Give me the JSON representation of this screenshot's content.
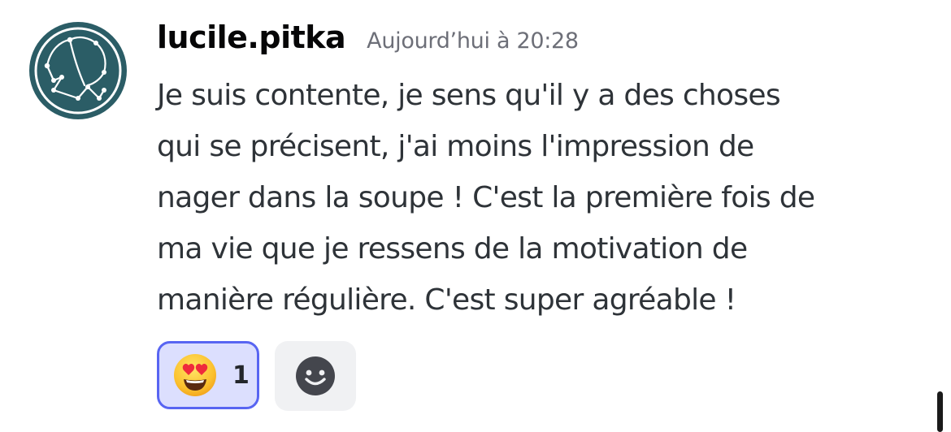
{
  "message": {
    "username": "lucile.pitka",
    "timestamp": "Aujourd’hui à 20:28",
    "lines": [
      "Je suis contente, je sens qu'il y a des choses",
      "qui se précisent, j'ai moins l'impression de",
      "nager dans la soupe ! C'est la première fois de",
      "ma vie que je ressens de la motivation de",
      "manière régulière. C'est super agréable !"
    ]
  },
  "reactions": [
    {
      "emoji": "heart-eyes-emoji",
      "count": "1",
      "selected": true
    }
  ],
  "colors": {
    "avatar_bg": "#2b5d66",
    "reaction_selected_bg": "#dcdffe",
    "reaction_selected_border": "#5865f2",
    "username": "#060607",
    "timestamp": "#6d6f78",
    "text": "#2e3338"
  }
}
